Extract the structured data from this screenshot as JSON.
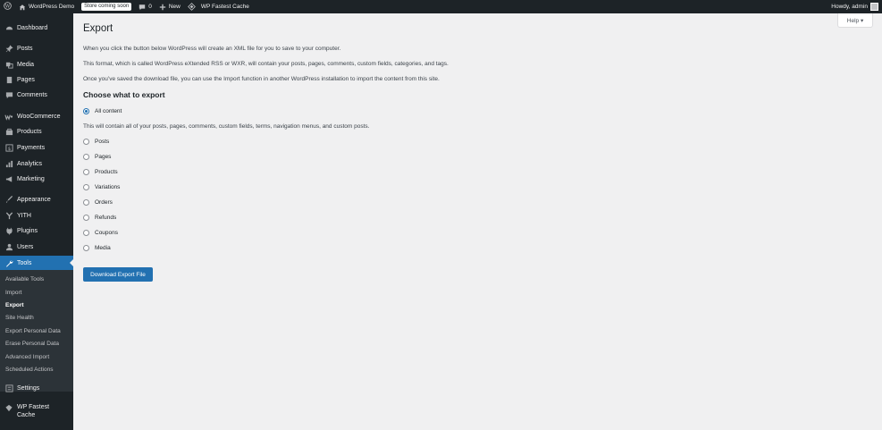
{
  "adminbar": {
    "site_name": "WordPress Demo",
    "store_badge": "Store coming soon",
    "comments_count": "0",
    "new_label": "New",
    "cache_label": "WP Fastest Cache",
    "howdy": "Howdy, admin"
  },
  "sidebar": {
    "items": [
      {
        "label": "Dashboard",
        "icon": "dashboard-icon"
      },
      {
        "label": "Posts",
        "icon": "pin-icon"
      },
      {
        "label": "Media",
        "icon": "media-icon"
      },
      {
        "label": "Pages",
        "icon": "pages-icon"
      },
      {
        "label": "Comments",
        "icon": "comment-icon"
      },
      {
        "label": "WooCommerce",
        "icon": "woo-icon"
      },
      {
        "label": "Products",
        "icon": "products-icon"
      },
      {
        "label": "Payments",
        "icon": "payments-icon"
      },
      {
        "label": "Analytics",
        "icon": "analytics-icon"
      },
      {
        "label": "Marketing",
        "icon": "megaphone-icon"
      },
      {
        "label": "Appearance",
        "icon": "brush-icon"
      },
      {
        "label": "YITH",
        "icon": "yith-icon"
      },
      {
        "label": "Plugins",
        "icon": "plug-icon"
      },
      {
        "label": "Users",
        "icon": "user-icon"
      },
      {
        "label": "Tools",
        "icon": "wrench-icon"
      },
      {
        "label": "Settings",
        "icon": "settings-icon"
      },
      {
        "label": "WP Fastest Cache",
        "icon": "cache-icon"
      }
    ],
    "submenu": [
      "Available Tools",
      "Import",
      "Export",
      "Site Health",
      "Export Personal Data",
      "Erase Personal Data",
      "Advanced Import",
      "Scheduled Actions"
    ],
    "current_submenu": "Export"
  },
  "help": {
    "label": "Help ▾"
  },
  "main": {
    "title": "Export",
    "intro1": "When you click the button below WordPress will create an XML file for you to save to your computer.",
    "intro2": "This format, which is called WordPress eXtended RSS or WXR, will contain your posts, pages, comments, custom fields, categories, and tags.",
    "intro3": "Once you’ve saved the download file, you can use the Import function in another WordPress installation to import the content from this site.",
    "choose_heading": "Choose what to export",
    "all_content": "All content",
    "all_content_desc": "This will contain all of your posts, pages, comments, custom fields, terms, navigation menus, and custom posts.",
    "options": [
      "Posts",
      "Pages",
      "Products",
      "Variations",
      "Orders",
      "Refunds",
      "Coupons",
      "Media"
    ],
    "download_button": "Download Export File"
  },
  "colors": {
    "accent": "#2271b1",
    "admin_dark": "#1d2327",
    "submenu_bg": "#2c3338",
    "page_bg": "#f0f0f1"
  }
}
